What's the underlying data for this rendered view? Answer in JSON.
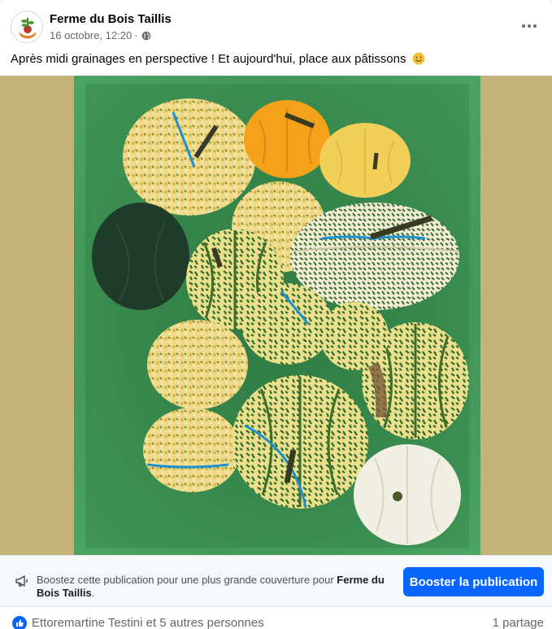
{
  "post": {
    "author": "Ferme du Bois Taillis",
    "date": "16 octobre, 12:20",
    "separator": "·",
    "privacy_icon": "globe-icon",
    "caption": "Après midi grainages en perspective ! Et aujourd'hui, place aux pâtissons",
    "caption_emoji": "smiling-face-icon",
    "image_alt": "Pâtissons (squash) in a green crate"
  },
  "boost": {
    "text_prefix": "Boostez cette publication pour une plus grande couverture pour ",
    "text_page": "Ferme du Bois Taillis",
    "text_suffix": ".",
    "button_label": "Booster la publication",
    "icon": "megaphone-icon"
  },
  "reactions": {
    "icon": "like-icon",
    "names": "Ettoremartine Testini et 5 autres personnes",
    "shares": "1 partage"
  },
  "colors": {
    "accent": "#0866ff",
    "secondary_text": "#65676b",
    "crate_green": "#3f9a5a",
    "background_tan": "#c4b27a"
  }
}
